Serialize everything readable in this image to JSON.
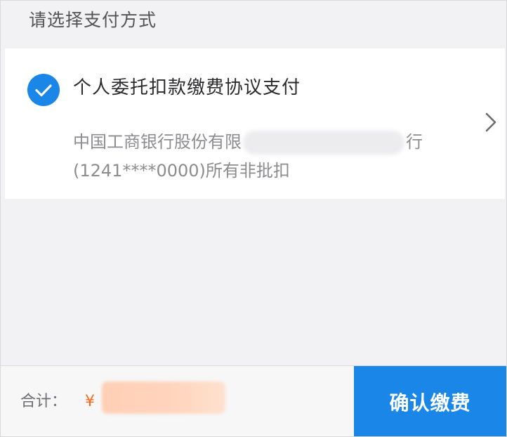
{
  "section_title": "请选择支付方式",
  "payment_method": {
    "name": "个人委托扣款缴费协议支付",
    "bank_line1_prefix": "中国工商银行股份有限",
    "bank_line1_suffix": "行",
    "bank_line2": "(1241****0000)所有非批扣",
    "selected": true
  },
  "footer": {
    "total_label": "合计：",
    "currency_symbol": "¥",
    "confirm_label": "确认缴费"
  },
  "colors": {
    "accent": "#1a87e8",
    "price": "#ff6a1a"
  },
  "icons": {
    "check": "check-icon",
    "chevron": "chevron-right-icon"
  }
}
